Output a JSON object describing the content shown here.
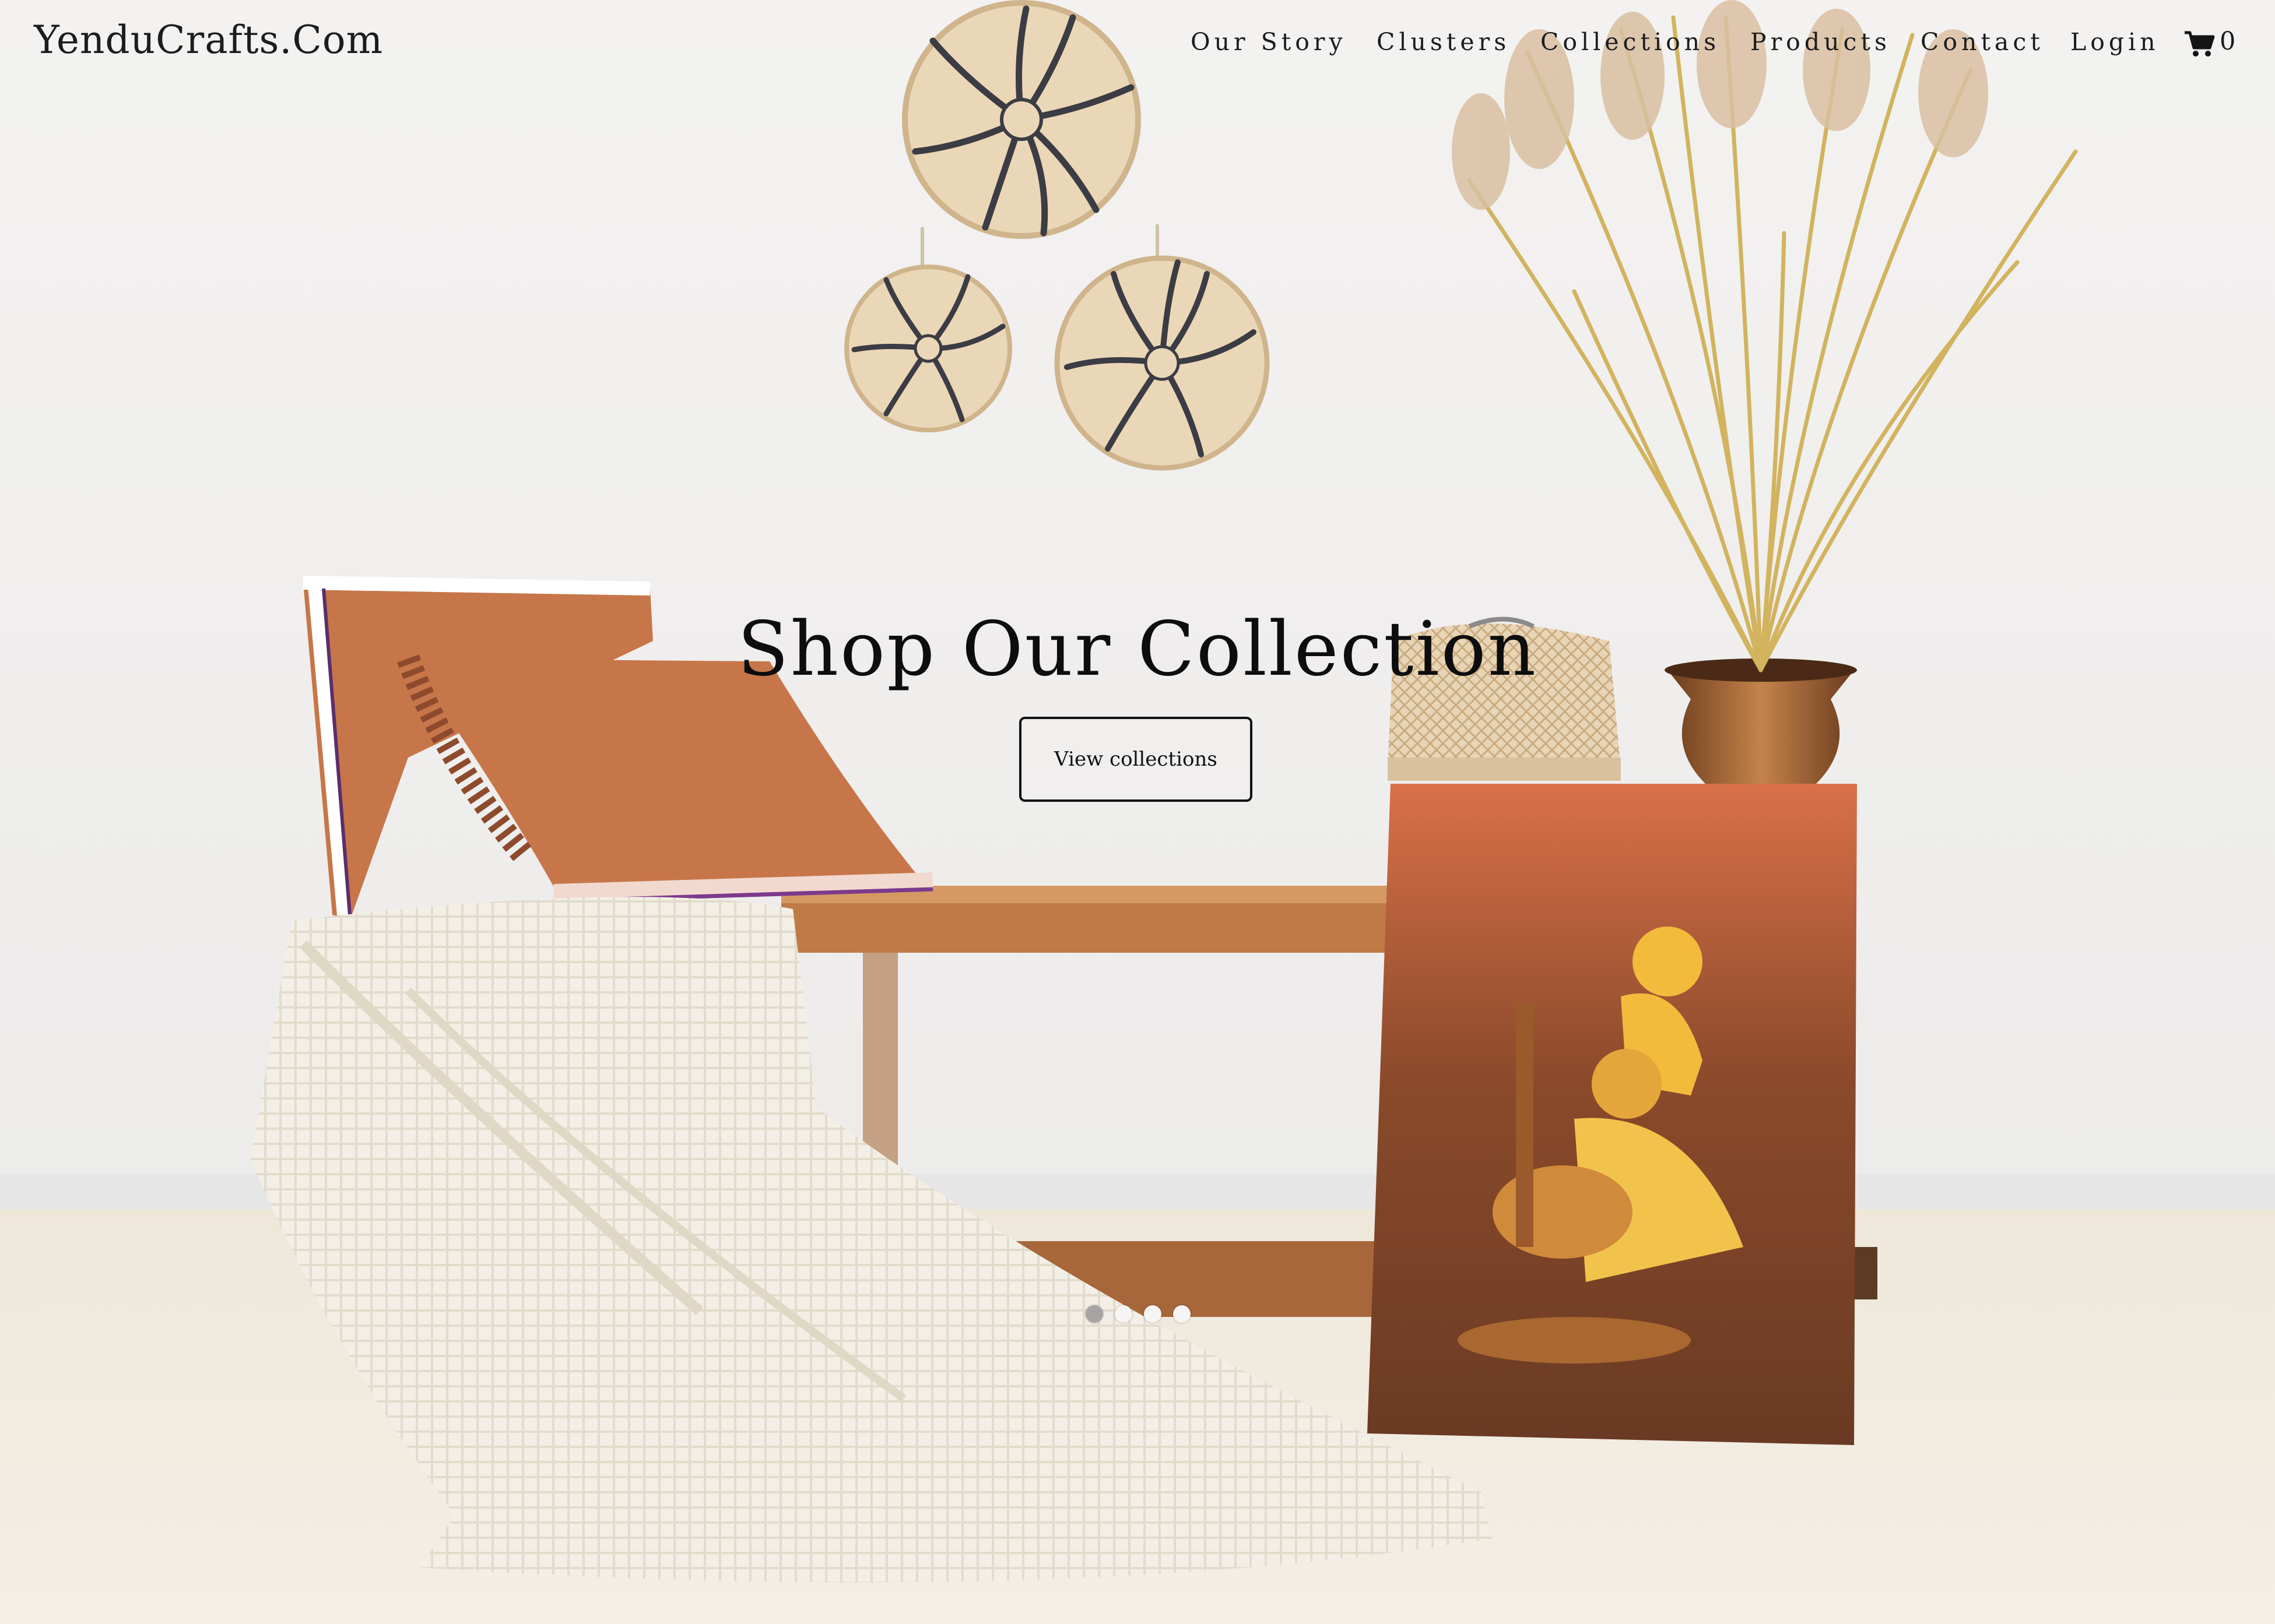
{
  "brand": {
    "logo": "YenduCrafts.Com"
  },
  "nav": {
    "items": [
      {
        "label": "Our Story"
      },
      {
        "label": "Clusters"
      },
      {
        "label": "Collections"
      },
      {
        "label": "Products"
      },
      {
        "label": "Contact"
      },
      {
        "label": "Login"
      }
    ],
    "cart_icon": "cart-icon",
    "cart_count": "0"
  },
  "hero": {
    "title": "Shop Our Collection",
    "cta_label": "View collections",
    "slides": {
      "count": 4,
      "active_index": 0
    }
  },
  "colors": {
    "text": "#111111",
    "wall": "#f1efee",
    "pillow": "#c7764a",
    "wood": "#b4703c"
  }
}
